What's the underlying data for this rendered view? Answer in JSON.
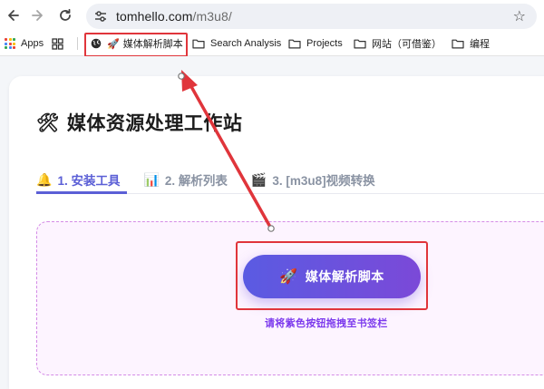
{
  "browser": {
    "url_host": "tomhello.com",
    "url_path": "/m3u8/"
  },
  "bookmarks": [
    {
      "label": "Apps",
      "icon": "apps-grid-icon"
    },
    {
      "label": "",
      "icon": "tab-groups-icon"
    },
    {
      "label": "媒体解析脚本",
      "icon": "globe-icon"
    },
    {
      "label": "Search Analysis",
      "icon": "folder-icon"
    },
    {
      "label": "Projects",
      "icon": "folder-icon"
    },
    {
      "label": "网站（可借鉴）",
      "icon": "folder-icon"
    },
    {
      "label": "编程",
      "icon": "folder-icon"
    }
  ],
  "page": {
    "title": "媒体资源处理工作站",
    "title_emoji": "🛠",
    "tabs": [
      {
        "icon": "🔔",
        "label": "1. 安装工具"
      },
      {
        "icon": "📊",
        "label": "2. 解析列表"
      },
      {
        "icon": "🎬",
        "label": "3. [m3u8]视频转换"
      }
    ],
    "bookmarklet_label": "媒体解析脚本",
    "bookmarklet_emoji": "🚀",
    "hint": "请将紫色按钮拖拽至书签栏"
  },
  "colors": {
    "accent": "#5b5fd6",
    "annotation_red": "#e0353b",
    "hint_purple": "#7c3aed"
  }
}
